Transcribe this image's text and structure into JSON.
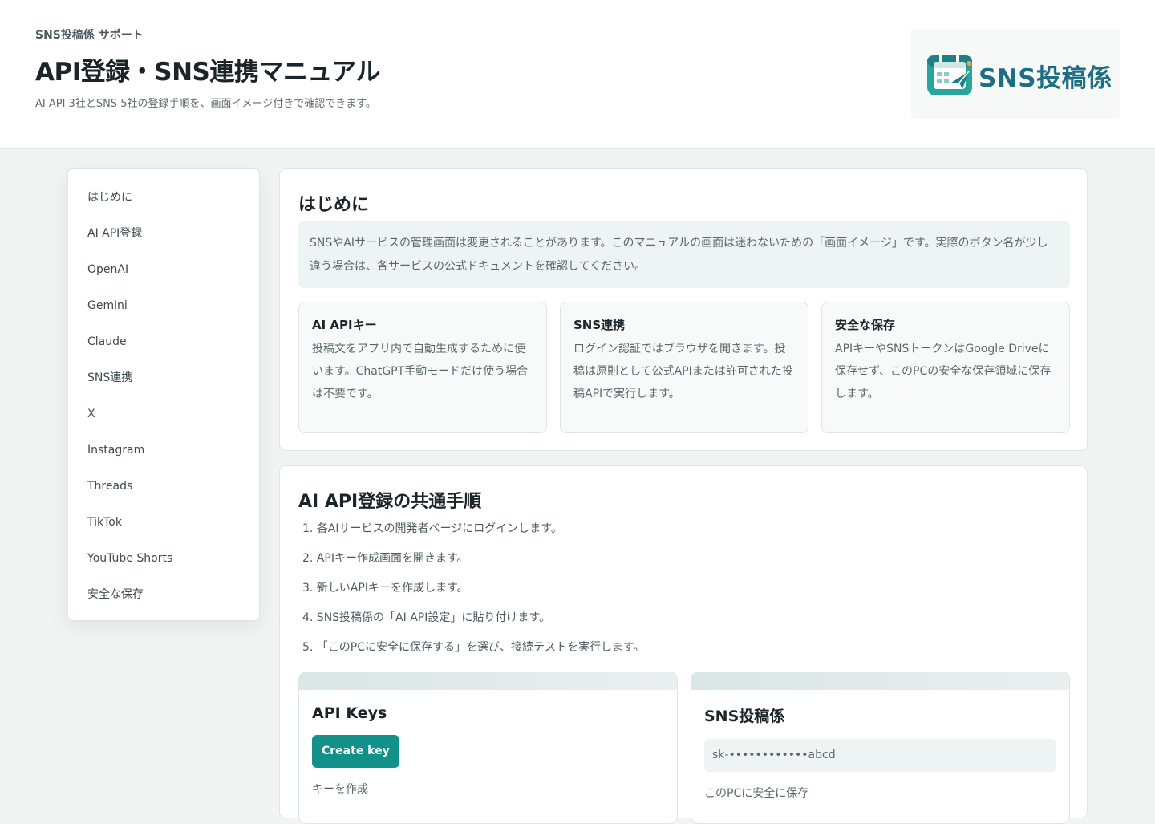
{
  "header": {
    "brand_label": "SNS投稿係 サポート",
    "title": "API登録・SNS連携マニュアル",
    "subtitle": "AI API 3社とSNS 5社の登録手順を、画面イメージ付きで確認できます。",
    "logo_text": "SNS投稿係",
    "logo_icon": "calendar-paper-plane-icon",
    "logo_color": "#1c6e80"
  },
  "sidebar": {
    "items": [
      {
        "label": "はじめに"
      },
      {
        "label": "AI API登録"
      },
      {
        "label": "OpenAI"
      },
      {
        "label": "Gemini"
      },
      {
        "label": "Claude"
      },
      {
        "label": "SNS連携"
      },
      {
        "label": "X"
      },
      {
        "label": "Instagram"
      },
      {
        "label": "Threads"
      },
      {
        "label": "TikTok"
      },
      {
        "label": "YouTube Shorts"
      },
      {
        "label": "安全な保存"
      }
    ]
  },
  "intro": {
    "title": "はじめに",
    "note": "SNSやAIサービスの管理画面は変更されることがあります。このマニュアルの画面は迷わないための「画面イメージ」です。実際のボタン名が少し違う場合は、各サービスの公式ドキュメントを確認してください。",
    "cards": [
      {
        "title": "AI APIキー",
        "body": "投稿文をアプリ内で自動生成するために使います。ChatGPT手動モードだけ使う場合は不要です。"
      },
      {
        "title": "SNS連携",
        "body": "ログイン認証ではブラウザを開きます。投稿は原則として公式APIまたは許可された投稿APIで実行します。"
      },
      {
        "title": "安全な保存",
        "body": "APIキーやSNSトークンはGoogle Driveに保存せず、このPCの安全な保存領域に保存します。"
      }
    ]
  },
  "ai_api": {
    "title": "AI API登録の共通手順",
    "steps": [
      "1. 各AIサービスの開発者ページにログインします。",
      "2. APIキー作成画面を開きます。",
      "3. 新しいAPIキーを作成します。",
      "4. SNS投稿係の「AI API設定」に貼り付けます。",
      "5. 「このPCに安全に保存する」を選び、接続テストを実行します。"
    ],
    "mock_left": {
      "title": "API Keys",
      "button_label": "Create key",
      "caption": "キーを作成"
    },
    "mock_right": {
      "title": "SNS投稿係",
      "key_value": "sk-••••••••••••abcd",
      "caption": "このPCに安全に保存"
    },
    "accent_color": "#12918a"
  }
}
